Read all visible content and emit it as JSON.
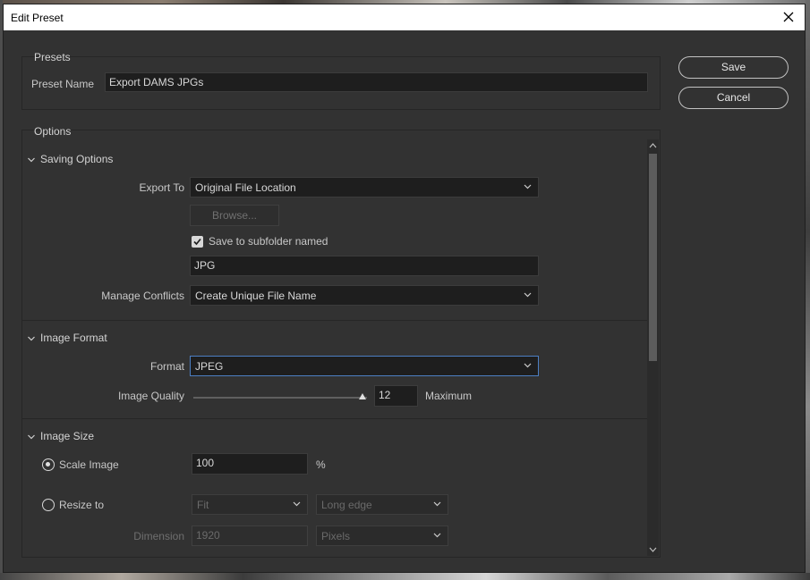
{
  "window": {
    "title": "Edit Preset"
  },
  "buttons": {
    "save": "Save",
    "cancel": "Cancel"
  },
  "presets": {
    "group_label": "Presets",
    "name_label": "Preset Name",
    "name_value": "Export DAMS JPGs"
  },
  "options": {
    "group_label": "Options"
  },
  "saving_options": {
    "header": "Saving Options",
    "export_to_label": "Export To",
    "export_to_value": "Original File Location",
    "browse_label": "Browse...",
    "subfolder_checkbox_label": "Save to subfolder named",
    "subfolder_checked": true,
    "subfolder_value": "JPG",
    "manage_conflicts_label": "Manage Conflicts",
    "manage_conflicts_value": "Create Unique File Name"
  },
  "image_format": {
    "header": "Image Format",
    "format_label": "Format",
    "format_value": "JPEG",
    "quality_label": "Image Quality",
    "quality_value": "12",
    "quality_level": 1.0,
    "quality_descriptor": "Maximum"
  },
  "image_size": {
    "header": "Image Size",
    "scale_label": "Scale Image",
    "scale_selected": true,
    "scale_value": "100",
    "scale_unit": "%",
    "resize_label": "Resize to",
    "resize_selected": false,
    "resize_mode_value": "Fit",
    "resize_edge_value": "Long edge",
    "dimension_label": "Dimension",
    "dimension_value": "1920",
    "dimension_unit_value": "Pixels"
  },
  "colors": {
    "dialog_bg": "#323232",
    "focus_border": "#4c7fc3",
    "field_bg": "#1e1e1e"
  }
}
